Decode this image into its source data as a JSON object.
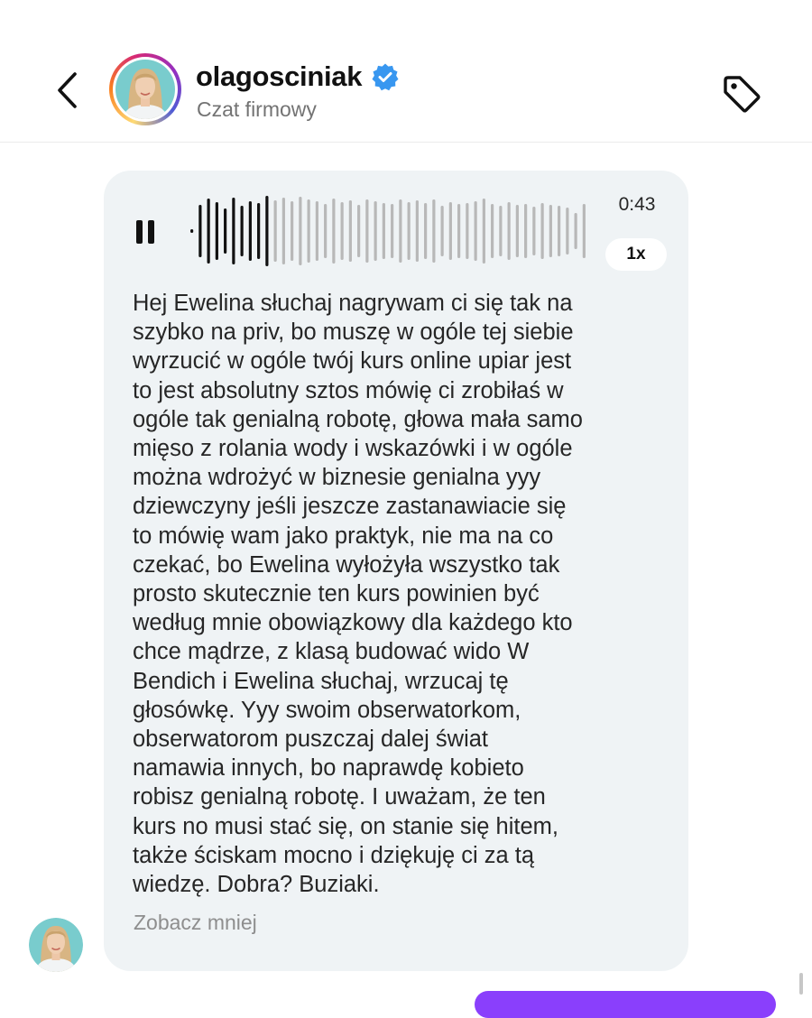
{
  "header": {
    "username": "olagosciniak",
    "subtitle": "Czat firmowy",
    "verified": true,
    "icons": {
      "back": "chevron-left-icon",
      "verified": "verified-badge-icon",
      "tag": "tag-icon"
    }
  },
  "voice_message": {
    "state": "playing",
    "duration": "0:43",
    "speed": "1x",
    "progress": 0.2,
    "icons": {
      "control": "pause-icon",
      "waveform": "waveform-icon"
    },
    "colors": {
      "played": "#111111",
      "unplayed": "#b8b8b8",
      "bubble": "#eff3f5"
    }
  },
  "transcript": {
    "lines": [
      "Hej Ewelina słuchaj nagrywam ci się tak na",
      "szybko na priv, bo muszę w ogóle tej siebie",
      "wyrzucić w ogóle twój kurs online upiar jest",
      "to jest absolutny sztos mówię ci zrobiłaś w",
      "ogóle tak genialną robotę, głowa mała samo",
      "mięso z rolania wody i wskazówki i w ogóle",
      "można wdrożyć w biznesie genialna yyy",
      "dziewczyny jeśli jeszcze zastanawiacie się",
      "to mówię wam jako praktyk, nie ma na co",
      "czekać, bo Ewelina wyłożyła wszystko tak",
      "prosto skutecznie ten kurs powinien być",
      "według mnie obowiązkowy dla każdego kto",
      "chce mądrze, z klasą budować wido W",
      "Bendich i Ewelina słuchaj, wrzucaj tę",
      "głosówkę. Yyy swoim obserwatorkom,",
      "obserwatorom puszczaj dalej świat",
      "namawia innych, bo naprawdę kobieto",
      "robisz genialną robotę. I uważam, że ten",
      "kurs no musi stać się, on stanie się hitem,",
      "także ściskam mocno i dziękuję ci za tą",
      "wiedzę. Dobra? Buziaki."
    ],
    "see_less": "Zobacz mniej"
  },
  "colors": {
    "accent_verified": "#3897f0",
    "next_bubble": "#8a3ffc",
    "secondary_text": "#737373"
  }
}
